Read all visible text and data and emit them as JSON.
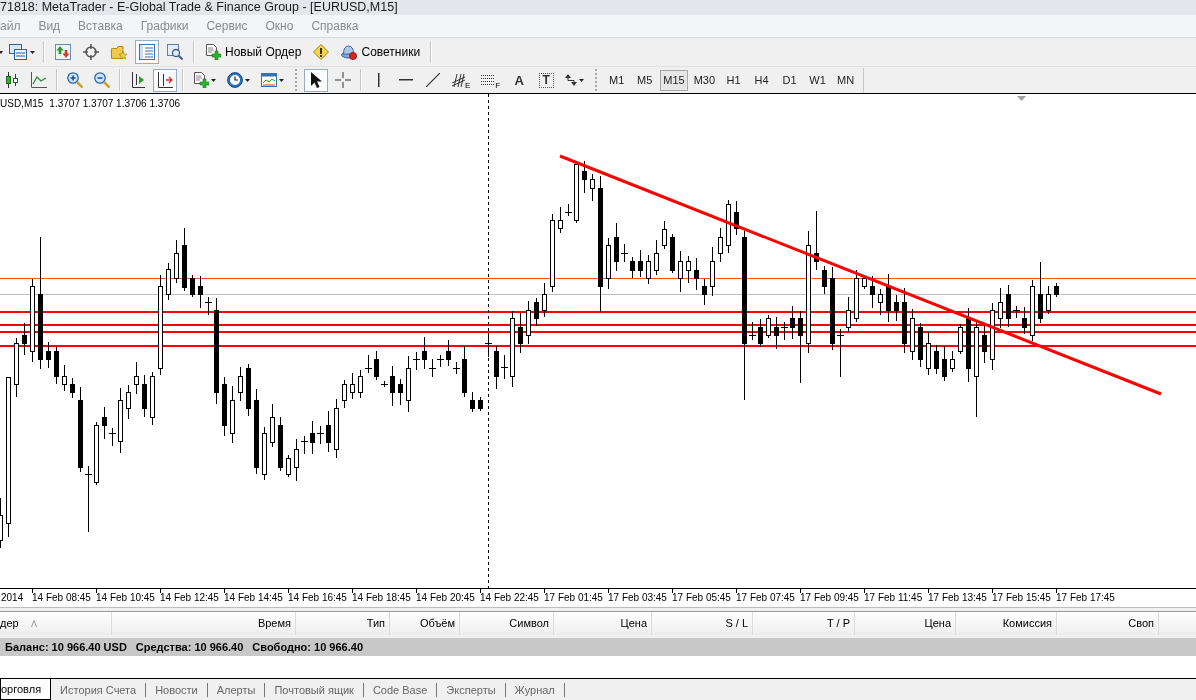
{
  "window": {
    "title": "71818: MetaTrader - E-Global Trade & Finance Group - [EURUSD,M15]"
  },
  "menu": [
    "айл",
    "Вид",
    "Вставка",
    "Графики",
    "Сервис",
    "Окно",
    "Справка"
  ],
  "toolbar_1": [
    {
      "pressed": false
    },
    {
      "pressed": false
    },
    {
      "pressed": false
    },
    {
      "pressed": false
    },
    {
      "pressed": true
    },
    {
      "pressed": false
    },
    {
      "label": "Новый Ордер",
      "pressed": false
    },
    {
      "pressed": false
    },
    {
      "label": "Советники",
      "pressed": false
    }
  ],
  "toolbar_2": [
    {
      "pressed": false
    },
    {
      "pressed": false
    },
    {
      "pressed": false
    },
    {
      "pressed": false
    },
    {
      "pressed": false
    },
    {
      "pressed": true
    },
    {
      "pressed": false
    },
    {
      "pressed": false
    },
    {
      "pressed": false
    },
    {
      "pressed": true
    },
    {
      "pressed": false
    },
    {
      "pressed": false
    },
    {
      "pressed": false
    },
    {
      "pressed": false
    },
    {
      "label": "E",
      "pressed": false
    },
    {
      "label": "F",
      "pressed": false
    },
    {
      "label": "A",
      "pressed": false
    },
    {
      "label": "T",
      "pressed": false
    },
    {
      "pressed": false
    }
  ],
  "timeframes": [
    {
      "label": "M1",
      "selected": false
    },
    {
      "label": "M5",
      "selected": false
    },
    {
      "label": "M15",
      "selected": true
    },
    {
      "label": "M30",
      "selected": false
    },
    {
      "label": "H1",
      "selected": false
    },
    {
      "label": "H4",
      "selected": false
    },
    {
      "label": "D1",
      "selected": false
    },
    {
      "label": "W1",
      "selected": false
    },
    {
      "label": "MN",
      "selected": false
    }
  ],
  "chart": {
    "symbol": "USD,M15",
    "ohlc": "1.3707 1.3707 1.3706 1.3706",
    "time_labels": [
      "2014",
      "14 Feb 08:45",
      "14 Feb 10:45",
      "14 Feb 12:45",
      "14 Feb 14:45",
      "14 Feb 16:45",
      "14 Feb 18:45",
      "14 Feb 20:45",
      "14 Feb 22:45",
      "17 Feb 01:45",
      "17 Feb 03:45",
      "17 Feb 05:45",
      "17 Feb 07:45",
      "17 Feb 09:45",
      "17 Feb 11:45",
      "17 Feb 13:45",
      "17 Feb 15:45",
      "17 Feb 17:45"
    ]
  },
  "terminal": {
    "columns": [
      "дер",
      "Время",
      "Тип",
      "Объём",
      "Символ",
      "Цена",
      "S / L",
      "T / P",
      "Цена",
      "Комиссия",
      "Своп"
    ],
    "balance": [
      "Баланс: 10 966.40 USD",
      "Средства: 10 966.40",
      "Свободно: 10 966.40"
    ],
    "tabs": [
      {
        "label": "орговля",
        "selected": true
      },
      {
        "label": "История Счета",
        "selected": false
      },
      {
        "label": "Новости",
        "selected": false
      },
      {
        "label": "Алерты",
        "selected": false
      },
      {
        "label": "Почтовый ящик",
        "selected": false
      },
      {
        "label": "Code Base",
        "selected": false
      },
      {
        "label": "Эксперты",
        "selected": false
      },
      {
        "label": "Журнал",
        "selected": false
      }
    ]
  }
}
